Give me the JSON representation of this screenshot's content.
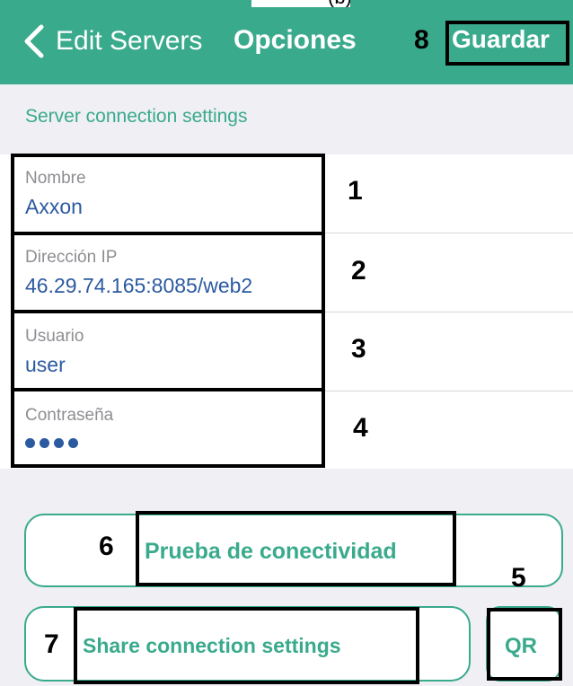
{
  "nav": {
    "back_label": "Edit Servers",
    "title": "Opciones",
    "save_label": "Guardar"
  },
  "top_clip_text": "(b)",
  "section": {
    "header": "Server connection settings"
  },
  "fields": {
    "name": {
      "label": "Nombre",
      "value": "Axxon"
    },
    "ip": {
      "label": "Dirección IP",
      "value": "46.29.74.165:8085/web2"
    },
    "user": {
      "label": "Usuario",
      "value": "user"
    },
    "password": {
      "label": "Contraseña",
      "masked_dot_count": 4
    }
  },
  "buttons": {
    "test_connectivity": "Prueba de conectividad",
    "share_settings": "Share connection settings",
    "qr": "QR"
  },
  "annotations": {
    "n1": "1",
    "n2": "2",
    "n3": "3",
    "n4": "4",
    "n5": "5",
    "n6": "6",
    "n7": "7",
    "n8": "8"
  },
  "colors": {
    "accent": "#3aaa8c",
    "value_text": "#2c5aa0",
    "label_text": "#8e8e93",
    "background": "#efeff4"
  },
  "icons": {
    "back": "chevron-left-icon",
    "password_dot": "bullet-icon"
  }
}
